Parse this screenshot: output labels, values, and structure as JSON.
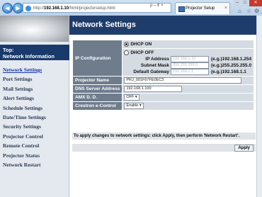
{
  "browser": {
    "url_prefix": "http://",
    "url_host": "192.168.1.10",
    "url_path": "/html/projectorsetup.html",
    "address_tools": "ρ – ¢ ×",
    "tab_title": "Projector Setup",
    "tab_close": "×"
  },
  "sidebar": {
    "top_label": "Top:",
    "top_title": "Network Information",
    "items": [
      {
        "label": "Network Settings",
        "active": true
      },
      {
        "label": "Port Settings"
      },
      {
        "label": "Mail Settings"
      },
      {
        "label": "Alert Settings"
      },
      {
        "label": "Schedule Settings"
      },
      {
        "label": "Date/Time Settings"
      },
      {
        "label": "Security Settings"
      },
      {
        "label": "Projector Control"
      },
      {
        "label": "Remote Control"
      },
      {
        "label": "Projector Status"
      },
      {
        "label": "Network Restart"
      }
    ]
  },
  "main": {
    "title": "Network Settings",
    "ip_configuration": {
      "label": "IP Configuration",
      "dhcp_on": "DHCP ON",
      "dhcp_off": "DHCP OFF",
      "selected": "dhcp_on",
      "ip_address": {
        "label": "IP Address",
        "value": "192.168.1.10",
        "example": "(e.g.)192.168.1.254"
      },
      "subnet_mask": {
        "label": "Subnet Mask",
        "value": "255.255.255.0",
        "example": "(e.g.)255.255.255.0"
      },
      "default_gateway": {
        "label": "Default Gateway",
        "value": "192.168.1.1",
        "example": "(e.g.)192.168.1.1"
      }
    },
    "projector_name": {
      "label": "Projector Name",
      "value": "PRJ_001F67FE0EC3"
    },
    "dns_server": {
      "label": "DNS Server Address",
      "value": "192.168.1.100"
    },
    "amx": {
      "label": "AMX D. D.",
      "value": "OFF"
    },
    "crestron": {
      "label": "Crestron e-Control",
      "value": "Enable"
    },
    "note": "To apply changes to network settings: click Apply, then perform 'Network Restart'.",
    "apply_label": "Apply"
  }
}
